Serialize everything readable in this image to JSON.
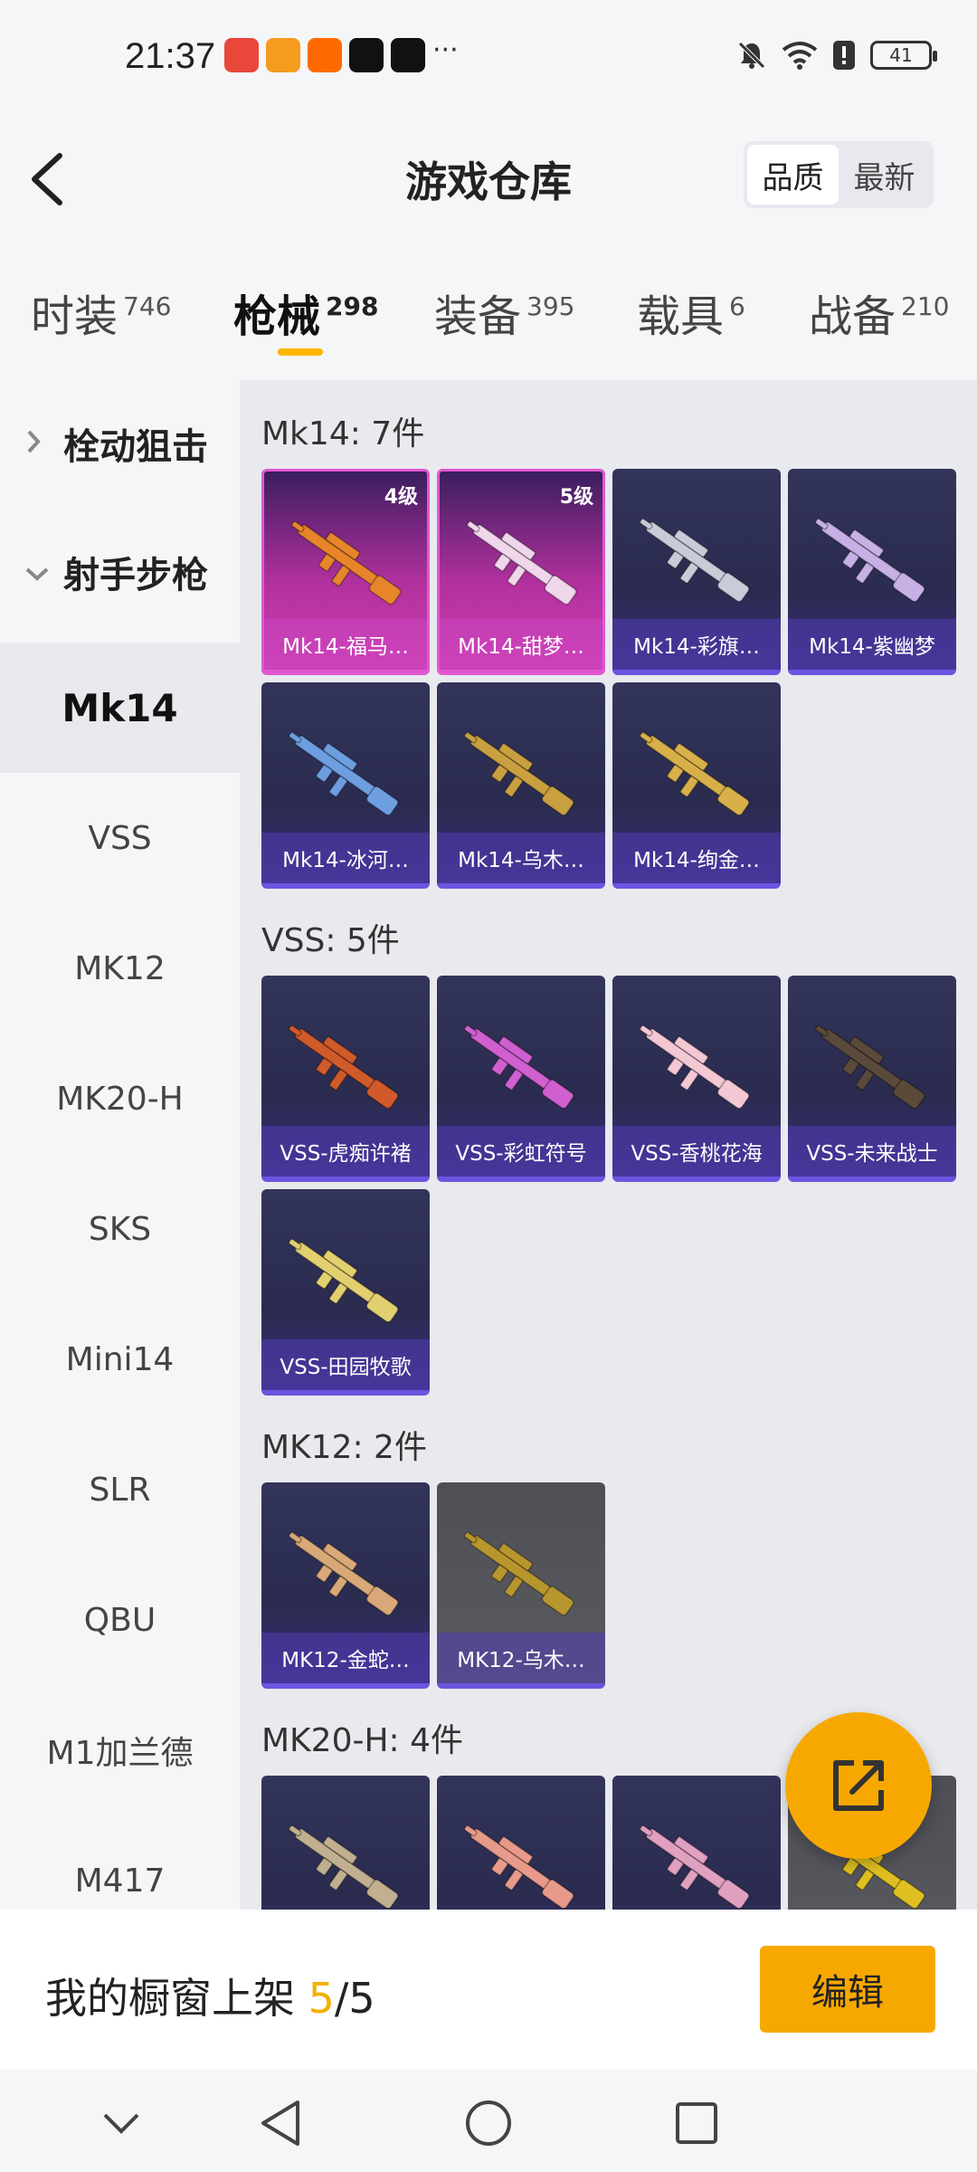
{
  "status_bar": {
    "time": "21:37",
    "more": "···",
    "battery": "41",
    "notification_apps": [
      "huawei-app-icon",
      "orange-app-icon",
      "taobao-icon",
      "tiktok-icon",
      "tiktok-icon"
    ]
  },
  "header": {
    "title": "游戏仓库",
    "sort_options": [
      {
        "label": "品质",
        "active": true
      },
      {
        "label": "最新",
        "active": false
      }
    ]
  },
  "category_tabs": [
    {
      "label": "时装",
      "count": "746",
      "active": false
    },
    {
      "label": "枪械",
      "count": "298",
      "active": true
    },
    {
      "label": "装备",
      "count": "395",
      "active": false
    },
    {
      "label": "载具",
      "count": "6",
      "active": false
    },
    {
      "label": "战备",
      "count": "210",
      "active": false
    }
  ],
  "sidebar": {
    "groups": [
      {
        "label": "栓动狙击",
        "expanded": false
      },
      {
        "label": "射手步枪",
        "expanded": true
      }
    ],
    "items": [
      {
        "label": "Mk14",
        "active": true
      },
      {
        "label": "VSS",
        "active": false
      },
      {
        "label": "MK12",
        "active": false
      },
      {
        "label": "MK20-H",
        "active": false
      },
      {
        "label": "SKS",
        "active": false
      },
      {
        "label": "Mini14",
        "active": false
      },
      {
        "label": "SLR",
        "active": false
      },
      {
        "label": "QBU",
        "active": false
      },
      {
        "label": "M1加兰德",
        "active": false
      },
      {
        "label": "M417",
        "active": false
      }
    ]
  },
  "sections": [
    {
      "title": "Mk14: 7件",
      "items": [
        {
          "name": "Mk14-福马…",
          "level": "4级",
          "style": "pink",
          "gun_color": "#e8852a"
        },
        {
          "name": "Mk14-甜梦…",
          "level": "5级",
          "style": "pink",
          "gun_color": "#f0d6ea"
        },
        {
          "name": "Mk14-彩旗…",
          "level": "",
          "style": "blue",
          "gun_color": "#c9ccd8"
        },
        {
          "name": "Mk14-紫幽梦",
          "level": "",
          "style": "blue",
          "gun_color": "#c6b0e6"
        },
        {
          "name": "Mk14-冰河…",
          "level": "",
          "style": "blue",
          "gun_color": "#6d9ee0"
        },
        {
          "name": "Mk14-乌木…",
          "level": "",
          "style": "blue",
          "gun_color": "#c8a040"
        },
        {
          "name": "Mk14-绚金…",
          "level": "",
          "style": "blue",
          "gun_color": "#d8b04a"
        }
      ]
    },
    {
      "title": "VSS: 5件",
      "items": [
        {
          "name": "VSS-虎痴许褚",
          "level": "",
          "style": "blue",
          "gun_color": "#d05a2a"
        },
        {
          "name": "VSS-彩虹符号",
          "level": "",
          "style": "blue",
          "gun_color": "#d060d0"
        },
        {
          "name": "VSS-香桃花海",
          "level": "",
          "style": "blue",
          "gun_color": "#f3c8d4"
        },
        {
          "name": "VSS-未来战士",
          "level": "",
          "style": "blue",
          "gun_color": "#5a4a3a"
        },
        {
          "name": "VSS-田园牧歌",
          "level": "",
          "style": "blue",
          "gun_color": "#e2d070"
        }
      ]
    },
    {
      "title": "MK12: 2件",
      "items": [
        {
          "name": "MK12-金蛇…",
          "level": "",
          "style": "blue",
          "gun_color": "#d8a878"
        },
        {
          "name": "MK12-乌木…",
          "level": "",
          "style": "gray",
          "gun_color": "#b8962e"
        }
      ]
    },
    {
      "title": "MK20-H: 4件",
      "items": [
        {
          "name": "",
          "level": "",
          "style": "blue",
          "gun_color": "#c0b090"
        },
        {
          "name": "",
          "level": "",
          "style": "blue",
          "gun_color": "#e89a8a"
        },
        {
          "name": "",
          "level": "",
          "style": "blue",
          "gun_color": "#e0a0c0"
        },
        {
          "name": "",
          "level": "",
          "style": "gray",
          "gun_color": "#e0c020"
        }
      ]
    }
  ],
  "bottom_bar": {
    "showcase_label": "我的橱窗上架 ",
    "current": "5",
    "total": "/5",
    "edit_label": "编辑"
  },
  "colors": {
    "accent": "#f7a800",
    "tab_underline": "#ffb400"
  }
}
